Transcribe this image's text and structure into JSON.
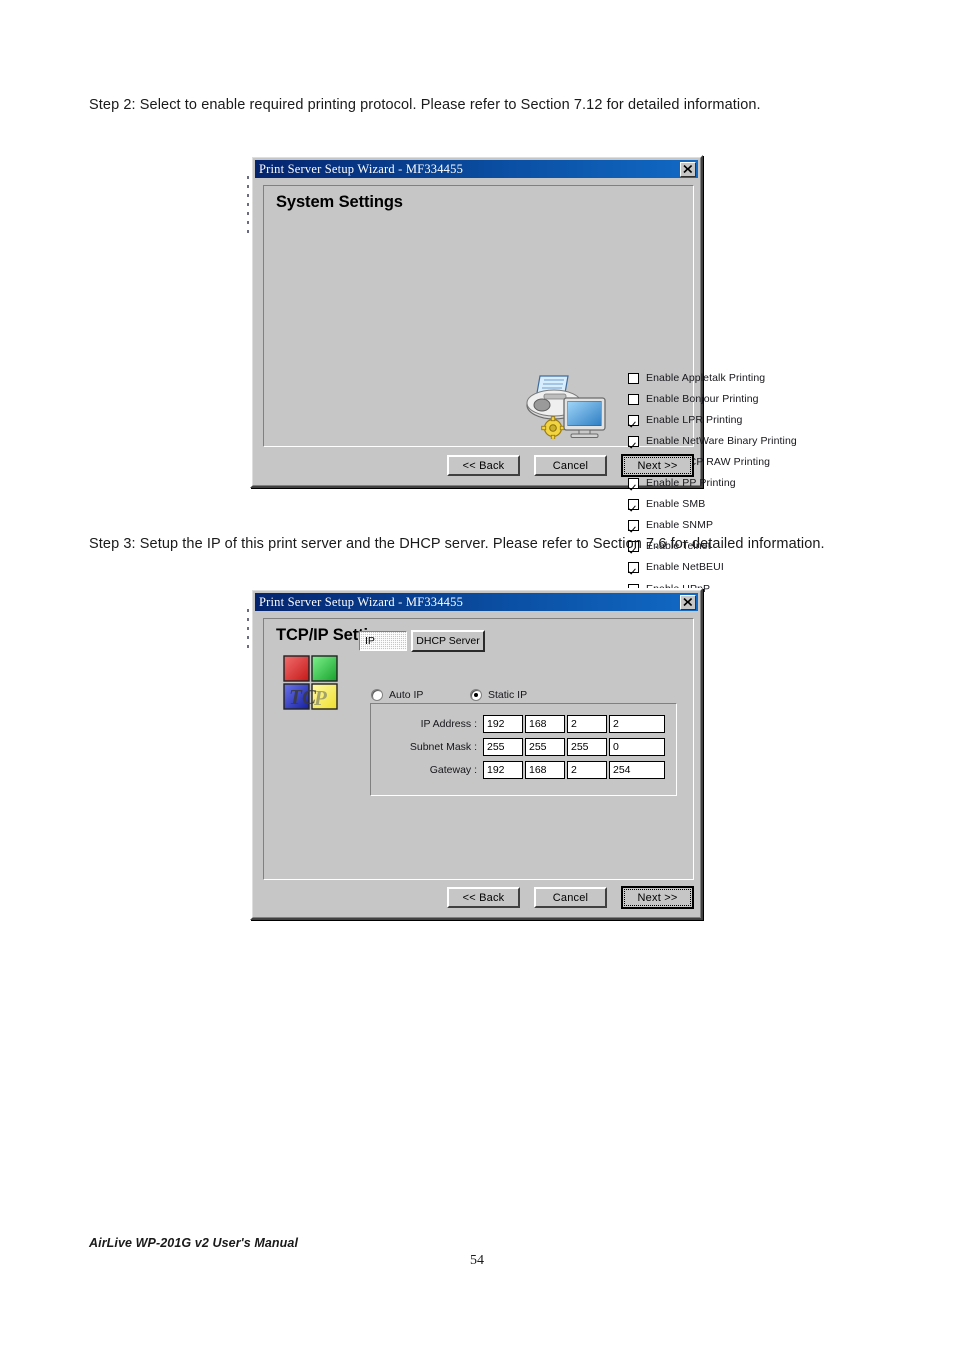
{
  "document": {
    "step2_text": "Step 2: Select to enable required printing protocol. Please refer to Section 7.12 for detailed information.",
    "step3_text": "Step 3: Setup the IP of this print server and the DHCP server. Please refer to Section 7.6 for detailed information.",
    "footer_manual": "AirLive WP-201G v2 User's Manual",
    "footer_page": "54"
  },
  "dialog1": {
    "title": "Print Server Setup Wizard - MF334455",
    "close_label": "close-icon",
    "heading": "System Settings",
    "icon_name": "printer-monitor-gear-icon",
    "checkboxes": [
      {
        "label": "Enable Appletalk Printing",
        "checked": false
      },
      {
        "label": "Enable Bonjour Printing",
        "checked": false
      },
      {
        "label": "Enable LPR Printing",
        "checked": true
      },
      {
        "label": "Enable NetWare Binary Printing",
        "checked": true
      },
      {
        "label": "Enable TCP RAW Printing",
        "checked": true
      },
      {
        "label": "Enable PP Printing",
        "checked": true
      },
      {
        "label": "Enable SMB",
        "checked": true
      },
      {
        "label": "Enable SNMP",
        "checked": true
      },
      {
        "label": "Enable Telnet",
        "checked": true
      },
      {
        "label": "Enable NetBEUI",
        "checked": true
      },
      {
        "label": "Enable UPnP",
        "checked": false
      }
    ],
    "buttons": {
      "back": "<< Back",
      "cancel": "Cancel",
      "next": "Next >>"
    }
  },
  "dialog2": {
    "title": "Print Server Setup Wizard - MF334455",
    "close_label": "close-icon",
    "heading": "TCP/IP Settings",
    "icon_name": "tcpip-squares-icon",
    "icon_text": "TCP",
    "tabs": [
      {
        "label": "IP",
        "selected": true
      },
      {
        "label": "DHCP Server",
        "selected": false
      }
    ],
    "radios": [
      {
        "label": "Auto IP",
        "selected": false
      },
      {
        "label": "Static IP",
        "selected": true
      }
    ],
    "ip_rows": [
      {
        "label": "IP Address :",
        "octets": [
          "192",
          "168",
          "2",
          "2"
        ]
      },
      {
        "label": "Subnet Mask :",
        "octets": [
          "255",
          "255",
          "255",
          "0"
        ]
      },
      {
        "label": "Gateway :",
        "octets": [
          "192",
          "168",
          "2",
          "254"
        ]
      }
    ],
    "buttons": {
      "back": "<< Back",
      "cancel": "Cancel",
      "next": "Next >>"
    }
  },
  "colors": {
    "titlebar_blue": "#0a4ea2",
    "dialog_face": "#c6c6c6",
    "square_red": "#e33b3b",
    "square_green": "#3fcb58",
    "square_blue": "#2b34c8",
    "square_yellow": "#f7ea4a"
  }
}
